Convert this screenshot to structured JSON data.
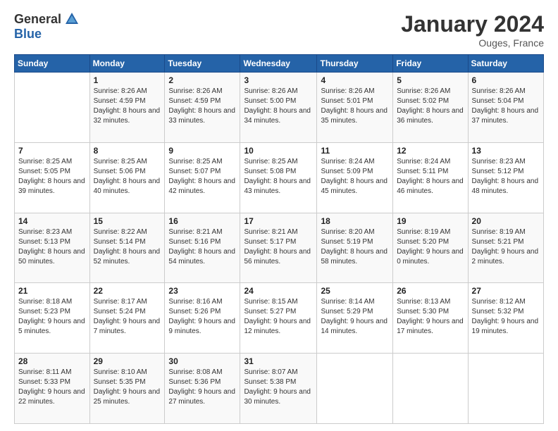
{
  "logo": {
    "general": "General",
    "blue": "Blue"
  },
  "title": "January 2024",
  "location": "Ouges, France",
  "days_header": [
    "Sunday",
    "Monday",
    "Tuesday",
    "Wednesday",
    "Thursday",
    "Friday",
    "Saturday"
  ],
  "weeks": [
    [
      {
        "day": "",
        "sunrise": "",
        "sunset": "",
        "daylight": ""
      },
      {
        "day": "1",
        "sunrise": "Sunrise: 8:26 AM",
        "sunset": "Sunset: 4:59 PM",
        "daylight": "Daylight: 8 hours and 32 minutes."
      },
      {
        "day": "2",
        "sunrise": "Sunrise: 8:26 AM",
        "sunset": "Sunset: 4:59 PM",
        "daylight": "Daylight: 8 hours and 33 minutes."
      },
      {
        "day": "3",
        "sunrise": "Sunrise: 8:26 AM",
        "sunset": "Sunset: 5:00 PM",
        "daylight": "Daylight: 8 hours and 34 minutes."
      },
      {
        "day": "4",
        "sunrise": "Sunrise: 8:26 AM",
        "sunset": "Sunset: 5:01 PM",
        "daylight": "Daylight: 8 hours and 35 minutes."
      },
      {
        "day": "5",
        "sunrise": "Sunrise: 8:26 AM",
        "sunset": "Sunset: 5:02 PM",
        "daylight": "Daylight: 8 hours and 36 minutes."
      },
      {
        "day": "6",
        "sunrise": "Sunrise: 8:26 AM",
        "sunset": "Sunset: 5:04 PM",
        "daylight": "Daylight: 8 hours and 37 minutes."
      }
    ],
    [
      {
        "day": "7",
        "sunrise": "Sunrise: 8:25 AM",
        "sunset": "Sunset: 5:05 PM",
        "daylight": "Daylight: 8 hours and 39 minutes."
      },
      {
        "day": "8",
        "sunrise": "Sunrise: 8:25 AM",
        "sunset": "Sunset: 5:06 PM",
        "daylight": "Daylight: 8 hours and 40 minutes."
      },
      {
        "day": "9",
        "sunrise": "Sunrise: 8:25 AM",
        "sunset": "Sunset: 5:07 PM",
        "daylight": "Daylight: 8 hours and 42 minutes."
      },
      {
        "day": "10",
        "sunrise": "Sunrise: 8:25 AM",
        "sunset": "Sunset: 5:08 PM",
        "daylight": "Daylight: 8 hours and 43 minutes."
      },
      {
        "day": "11",
        "sunrise": "Sunrise: 8:24 AM",
        "sunset": "Sunset: 5:09 PM",
        "daylight": "Daylight: 8 hours and 45 minutes."
      },
      {
        "day": "12",
        "sunrise": "Sunrise: 8:24 AM",
        "sunset": "Sunset: 5:11 PM",
        "daylight": "Daylight: 8 hours and 46 minutes."
      },
      {
        "day": "13",
        "sunrise": "Sunrise: 8:23 AM",
        "sunset": "Sunset: 5:12 PM",
        "daylight": "Daylight: 8 hours and 48 minutes."
      }
    ],
    [
      {
        "day": "14",
        "sunrise": "Sunrise: 8:23 AM",
        "sunset": "Sunset: 5:13 PM",
        "daylight": "Daylight: 8 hours and 50 minutes."
      },
      {
        "day": "15",
        "sunrise": "Sunrise: 8:22 AM",
        "sunset": "Sunset: 5:14 PM",
        "daylight": "Daylight: 8 hours and 52 minutes."
      },
      {
        "day": "16",
        "sunrise": "Sunrise: 8:21 AM",
        "sunset": "Sunset: 5:16 PM",
        "daylight": "Daylight: 8 hours and 54 minutes."
      },
      {
        "day": "17",
        "sunrise": "Sunrise: 8:21 AM",
        "sunset": "Sunset: 5:17 PM",
        "daylight": "Daylight: 8 hours and 56 minutes."
      },
      {
        "day": "18",
        "sunrise": "Sunrise: 8:20 AM",
        "sunset": "Sunset: 5:19 PM",
        "daylight": "Daylight: 8 hours and 58 minutes."
      },
      {
        "day": "19",
        "sunrise": "Sunrise: 8:19 AM",
        "sunset": "Sunset: 5:20 PM",
        "daylight": "Daylight: 9 hours and 0 minutes."
      },
      {
        "day": "20",
        "sunrise": "Sunrise: 8:19 AM",
        "sunset": "Sunset: 5:21 PM",
        "daylight": "Daylight: 9 hours and 2 minutes."
      }
    ],
    [
      {
        "day": "21",
        "sunrise": "Sunrise: 8:18 AM",
        "sunset": "Sunset: 5:23 PM",
        "daylight": "Daylight: 9 hours and 5 minutes."
      },
      {
        "day": "22",
        "sunrise": "Sunrise: 8:17 AM",
        "sunset": "Sunset: 5:24 PM",
        "daylight": "Daylight: 9 hours and 7 minutes."
      },
      {
        "day": "23",
        "sunrise": "Sunrise: 8:16 AM",
        "sunset": "Sunset: 5:26 PM",
        "daylight": "Daylight: 9 hours and 9 minutes."
      },
      {
        "day": "24",
        "sunrise": "Sunrise: 8:15 AM",
        "sunset": "Sunset: 5:27 PM",
        "daylight": "Daylight: 9 hours and 12 minutes."
      },
      {
        "day": "25",
        "sunrise": "Sunrise: 8:14 AM",
        "sunset": "Sunset: 5:29 PM",
        "daylight": "Daylight: 9 hours and 14 minutes."
      },
      {
        "day": "26",
        "sunrise": "Sunrise: 8:13 AM",
        "sunset": "Sunset: 5:30 PM",
        "daylight": "Daylight: 9 hours and 17 minutes."
      },
      {
        "day": "27",
        "sunrise": "Sunrise: 8:12 AM",
        "sunset": "Sunset: 5:32 PM",
        "daylight": "Daylight: 9 hours and 19 minutes."
      }
    ],
    [
      {
        "day": "28",
        "sunrise": "Sunrise: 8:11 AM",
        "sunset": "Sunset: 5:33 PM",
        "daylight": "Daylight: 9 hours and 22 minutes."
      },
      {
        "day": "29",
        "sunrise": "Sunrise: 8:10 AM",
        "sunset": "Sunset: 5:35 PM",
        "daylight": "Daylight: 9 hours and 25 minutes."
      },
      {
        "day": "30",
        "sunrise": "Sunrise: 8:08 AM",
        "sunset": "Sunset: 5:36 PM",
        "daylight": "Daylight: 9 hours and 27 minutes."
      },
      {
        "day": "31",
        "sunrise": "Sunrise: 8:07 AM",
        "sunset": "Sunset: 5:38 PM",
        "daylight": "Daylight: 9 hours and 30 minutes."
      },
      {
        "day": "",
        "sunrise": "",
        "sunset": "",
        "daylight": ""
      },
      {
        "day": "",
        "sunrise": "",
        "sunset": "",
        "daylight": ""
      },
      {
        "day": "",
        "sunrise": "",
        "sunset": "",
        "daylight": ""
      }
    ]
  ]
}
